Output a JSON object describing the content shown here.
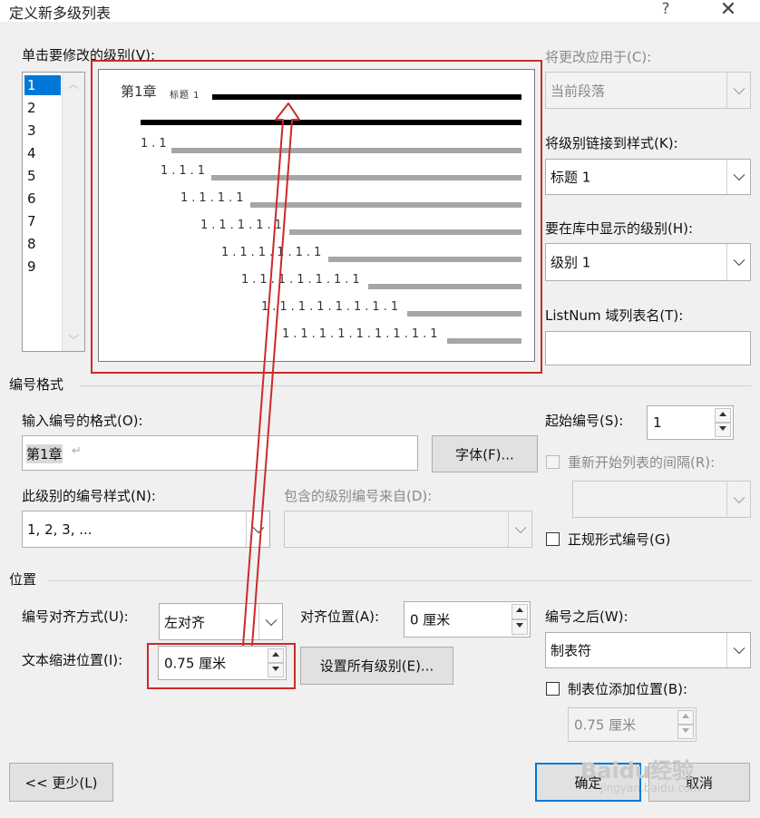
{
  "dialog": {
    "title": "定义新多级列表",
    "help_symbol": "?",
    "close_symbol": "✕"
  },
  "levels": {
    "label": "单击要修改的级别(V):",
    "items": [
      "1",
      "2",
      "3",
      "4",
      "5",
      "6",
      "7",
      "8",
      "9"
    ],
    "selected": "1"
  },
  "preview": {
    "heading_prefix": "第1章",
    "heading_style": "标题 1",
    "rows": [
      "1.1",
      "1.1.1",
      "1.1.1.1",
      "1.1.1.1.1",
      "1.1.1.1.1.1",
      "1.1.1.1.1.1.1",
      "1.1.1.1.1.1.1.1",
      "1.1.1.1.1.1.1.1.1"
    ]
  },
  "right_panel": {
    "apply_to_label": "将更改应用于(C):",
    "apply_to_value": "当前段落",
    "link_style_label": "将级别链接到样式(K):",
    "link_style_value": "标题 1",
    "gallery_level_label": "要在库中显示的级别(H):",
    "gallery_level_value": "级别 1",
    "listnum_label": "ListNum 域列表名(T):",
    "listnum_value": ""
  },
  "number_format": {
    "section_title": "编号格式",
    "format_label": "输入编号的格式(O):",
    "format_value": "第1章",
    "paragraph_mark": "↵",
    "font_button": "字体(F)...",
    "style_label": "此级别的编号样式(N):",
    "style_value": "1, 2, 3, ...",
    "include_label": "包含的级别编号来自(D):",
    "include_value": "",
    "start_label": "起始编号(S):",
    "start_value": "1",
    "restart_label": "重新开始列表的间隔(R):",
    "restart_value": "",
    "legal_label": "正规形式编号(G)"
  },
  "position": {
    "section_title": "位置",
    "align_label": "编号对齐方式(U):",
    "align_value": "左对齐",
    "align_at_label": "对齐位置(A):",
    "align_at_value": "0 厘米",
    "indent_label": "文本缩进位置(I):",
    "indent_value": "0.75 厘米",
    "set_all_button": "设置所有级别(E)...",
    "follow_label": "编号之后(W):",
    "follow_value": "制表符",
    "tab_add_label": "制表位添加位置(B):",
    "tab_add_value": "0.75 厘米"
  },
  "footer": {
    "less_button": "<< 更少(L)",
    "ok_button": "确定",
    "cancel_button": "取消"
  },
  "watermark": {
    "text": "Baidu经验",
    "url": "jingyan.baidu.com"
  },
  "colors": {
    "selection": "#0078d7",
    "annotation_red": "#cc2a2a",
    "preview_bar_dark": "#000000",
    "preview_bar_gray": "#a6a6a6"
  }
}
